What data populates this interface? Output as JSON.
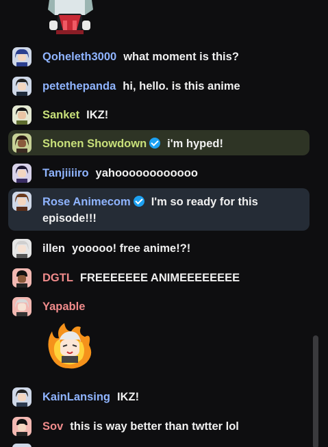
{
  "chat": {
    "messages": [
      {
        "user": "Qoheleth3000",
        "text": "what moment is this?",
        "color": "#8fb4ff",
        "avatar": "avatar-icon"
      },
      {
        "user": "petethepanda",
        "text": "hi, hello. is this anime",
        "color": "#8fb4ff",
        "avatar": "avatar-icon"
      },
      {
        "user": "Sanket",
        "text": "IKZ!",
        "color": "#c8e07a",
        "avatar": "avatar-icon"
      },
      {
        "user": "Shonen Showdown",
        "text": "i'm hyped!",
        "color": "#c8e07a",
        "avatar": "avatar-icon",
        "badge": "verified-icon"
      },
      {
        "user": "Tanjiiiiro",
        "text": "yahoooooooooooo",
        "color": "#8fb4ff",
        "avatar": "avatar-icon"
      },
      {
        "user": "Rose Animecom",
        "text": "I'm so ready for this episode!!!",
        "color": "#8fb4ff",
        "avatar": "avatar-icon",
        "badge": "verified-icon"
      },
      {
        "user": "illen",
        "text": "yooooo! free anime!?!",
        "color": "#efeff1",
        "avatar": "avatar-icon"
      },
      {
        "user": "DGTL",
        "text": "FREEEEEEE ANIMEEEEEEEE",
        "color": "#f08b8b",
        "avatar": "avatar-icon"
      },
      {
        "user": "Yapable",
        "text": "",
        "color": "#f08b8b",
        "avatar": "avatar-icon"
      },
      {
        "user": "KainLansing",
        "text": "IKZ!",
        "color": "#8fb4ff",
        "avatar": "avatar-icon"
      },
      {
        "user": "Sov",
        "text": "this is way better than twtter lol",
        "color": "#f08b8b",
        "avatar": "avatar-icon"
      }
    ]
  },
  "colors": {
    "background": "#0e0e10",
    "highlight_green": "#2e3425",
    "highlight_blue": "#252c36",
    "verified_badge": "#1da1f2"
  }
}
